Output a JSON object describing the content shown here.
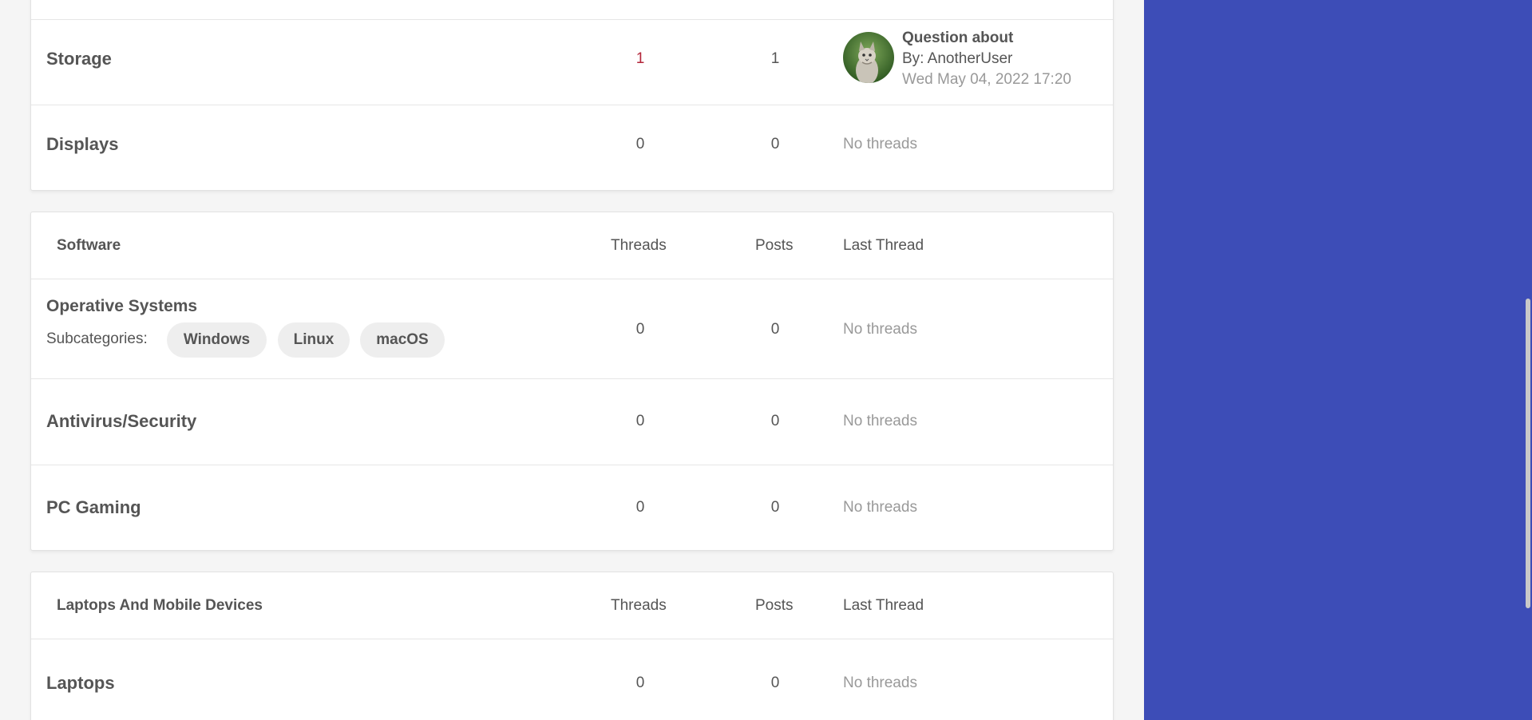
{
  "hardware": {
    "rows": [
      {
        "name": "Storage",
        "threads": "1",
        "posts": "1",
        "last_thread": {
          "title": "Question about",
          "by": "By: AnotherUser",
          "date": "Wed May 04, 2022 17:20"
        }
      },
      {
        "name": "Displays",
        "threads": "0",
        "posts": "0",
        "last_thread_empty": "No threads"
      }
    ]
  },
  "software": {
    "title": "Software",
    "col_threads": "Threads",
    "col_posts": "Posts",
    "col_last": "Last Thread",
    "rows": [
      {
        "name": "Operative Systems",
        "subcategories_label": "Subcategories:",
        "subcategories": [
          "Windows",
          "Linux",
          "macOS"
        ],
        "threads": "0",
        "posts": "0",
        "last_thread_empty": "No threads"
      },
      {
        "name": "Antivirus/Security",
        "threads": "0",
        "posts": "0",
        "last_thread_empty": "No threads"
      },
      {
        "name": "PC Gaming",
        "threads": "0",
        "posts": "0",
        "last_thread_empty": "No threads"
      }
    ]
  },
  "laptops": {
    "title": "Laptops And Mobile Devices",
    "col_threads": "Threads",
    "col_posts": "Posts",
    "col_last": "Last Thread",
    "rows": [
      {
        "name": "Laptops",
        "threads": "0",
        "posts": "0",
        "last_thread_empty": "No threads"
      }
    ]
  },
  "colors": {
    "sidebar": "#3d4db7",
    "thread_count_highlight": "#b3263a"
  },
  "icons": {
    "avatar": "cat-avatar-icon"
  }
}
